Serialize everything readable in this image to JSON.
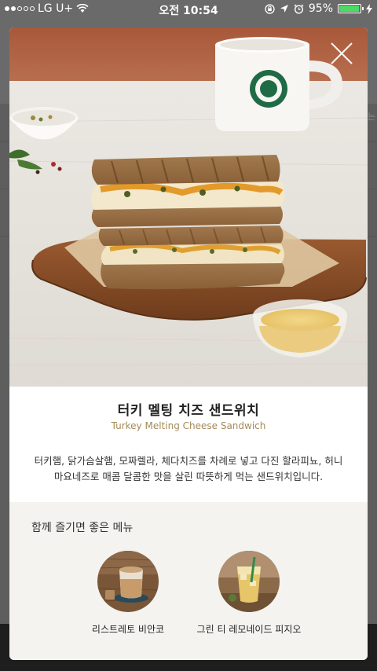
{
  "status_bar": {
    "carrier": "LG U+",
    "time": "오전 10:54",
    "battery": "95%",
    "battery_level": 0.95
  },
  "background": {
    "edge_text": "는"
  },
  "product": {
    "name_ko": "터키 멜팅 치즈 샌드위치",
    "name_en": "Turkey Melting Cheese Sandwich",
    "description": "터키햄, 닭가슴살햄, 모짜렐라, 체다치즈를 차례로 넣고 다진 할라피뇨, 허니마요네즈로 매콤 달콤한 맛을 살린 따뜻하게 먹는 샌드위치입니다."
  },
  "recommend": {
    "title": "함께 즐기면 좋은 메뉴",
    "items": [
      {
        "name": "리스트레토 비안코"
      },
      {
        "name": "그린 티 레모네이드 피지오"
      }
    ]
  },
  "colors": {
    "accent": "#a48b5a",
    "recommend_bg": "#f4f3f0",
    "battery_green": "#4cd964"
  },
  "icons": [
    "close-icon",
    "wifi-icon",
    "lock-rotation-icon",
    "location-icon",
    "alarm-icon",
    "battery-icon",
    "charging-icon"
  ]
}
